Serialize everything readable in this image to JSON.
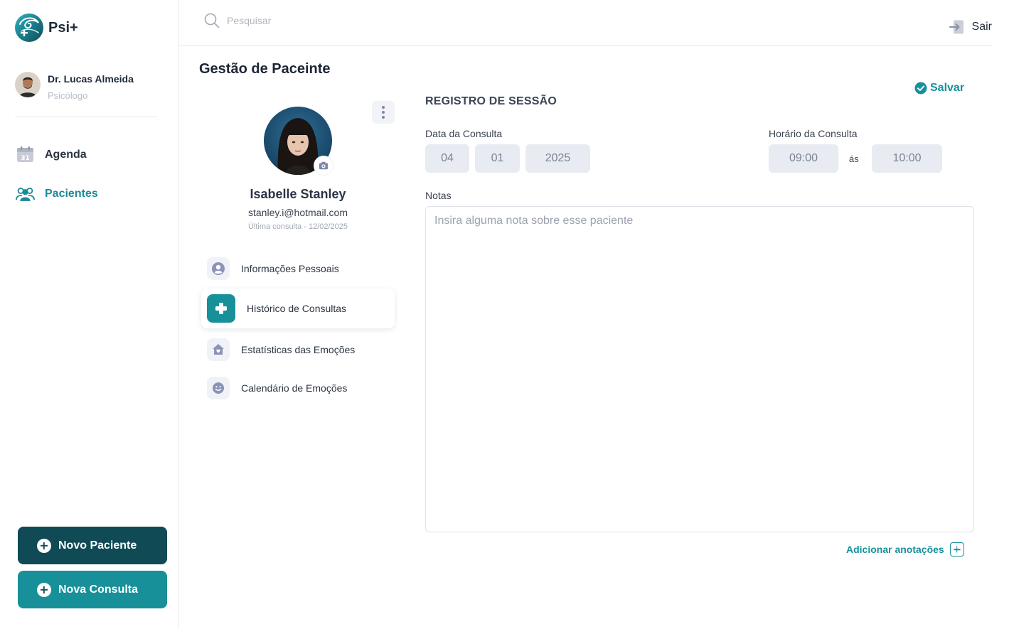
{
  "app": {
    "name": "Psi+"
  },
  "user": {
    "name": "Dr. Lucas Almeida",
    "role": "Psicólogo"
  },
  "nav": {
    "items": [
      {
        "label": "Agenda",
        "icon": "calendar-icon"
      },
      {
        "label": "Pacientes",
        "icon": "users-icon",
        "active": true
      }
    ]
  },
  "actions": {
    "new_patient": "Novo Paciente",
    "new_appointment": "Nova Consulta"
  },
  "topbar": {
    "search_placeholder": "Pesquisar",
    "logout": "Sair"
  },
  "page": {
    "title": "Gestão de Paceinte"
  },
  "patient": {
    "name": "Isabelle Stanley",
    "email": "stanley.i@hotmail.com",
    "last_visit": "Última consulta - 12/02/2025"
  },
  "patient_menu": [
    {
      "label": "Informações Pessoais",
      "icon": "user-circle-icon"
    },
    {
      "label": "Histórico de Consultas",
      "icon": "medical-cross-icon",
      "active": true
    },
    {
      "label": "Estatísticas das Emoções",
      "icon": "home-heart-icon"
    },
    {
      "label": "Calendário de Emoções",
      "icon": "smile-icon"
    }
  ],
  "session": {
    "title": "REGISTRO DE SESSÃO",
    "save": "Salvar",
    "date_label": "Data da Consulta",
    "day": "04",
    "month": "01",
    "year": "2025",
    "time_label": "Horário da Consulta",
    "start": "09:00",
    "separator": "ás",
    "end": "10:00",
    "notes_label": "Notas",
    "notes_placeholder": "Insira alguma nota sobre esse paciente",
    "add_notes": "Adicionar anotações"
  },
  "colors": {
    "brand": "#17909a",
    "brand_dark": "#0f4a55",
    "field_bg": "#e8ebf1"
  }
}
